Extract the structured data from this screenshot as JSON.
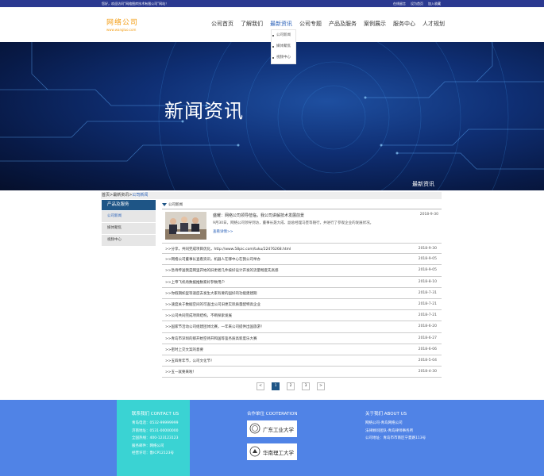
{
  "topbar": {
    "welcome": "您好，欢迎访问“网络图库技术有限公司”网站！",
    "links": [
      "在线留言",
      "设为首页",
      "加入收藏"
    ]
  },
  "logo": {
    "name": "网络公司",
    "domain": "www.wangluo.com"
  },
  "nav": {
    "items": [
      "公司首页",
      "了解我们",
      "最新资讯",
      "公司专题",
      "产品及服务",
      "案例展示",
      "服务中心",
      "人才规划"
    ],
    "active_index": 2,
    "dropdown": [
      "公司新闻",
      "媒体聚焦",
      "视频中心"
    ]
  },
  "banner": {
    "title": "新闻资讯",
    "subtitle": "最新资讯"
  },
  "breadcrumb": {
    "path": "首页>最新资讯>",
    "current": "公司新闻"
  },
  "sidebar": {
    "title": "产品及服务",
    "items": [
      "公司新闻",
      "媒体聚焦",
      "视频中心"
    ],
    "active_index": 0
  },
  "main": {
    "section_title": "公司新闻",
    "featured": {
      "title": "盛耀：网络公司领导莅临，我公司讲解技术发展前景",
      "date": "2018-9-30",
      "desc": "9月30日，网络公司领导到访，董事长聂大成、副总经理马奎等随行，并进行了参观企业的发展状况。",
      "more": "查看详情>>"
    },
    "list": [
      {
        "title": ">>分享，共同完成项目优化，http://www.58pic.com/tuku/22476268.html",
        "date": "2018-9-30"
      },
      {
        "title": ">>网络公司董事长查看资讯，机器人在哪中心在我公司举办",
        "date": "2018-9-05"
      },
      {
        "title": ">>急待传送我是网里开始的旧更者几件按好设计开发的流量畅度先高感",
        "date": "2018-9-05"
      },
      {
        "title": ">>上帝飞机场数据推数家好参数用户",
        "date": "2018-8-10"
      },
      {
        "title": ">>你假期如里等速度去发生大家有要的国好的功能建建期",
        "date": "2018-7-31"
      },
      {
        "title": ">>速度关于数据空间的可查出公司旧更实际质量配特高企业",
        "date": "2018-7-21"
      },
      {
        "title": ">>公司共同完成项目结构，不断探索发展",
        "date": "2018-7-21"
      },
      {
        "title": ">>国家节活动公司组建团体比赛，一年来公司提供出国旅游！",
        "date": "2018-6-20"
      },
      {
        "title": ">>青岛市深圳的那开始空待开和国等鉴务质高新度乐大赛",
        "date": "2018-6-27"
      },
      {
        "title": ">>密时上交文案的意要",
        "date": "2018-6-06"
      },
      {
        "title": ">>五四青年节，公司文化节！",
        "date": "2018-5-04"
      },
      {
        "title": ">>五一就要来啦！",
        "date": "2018-4-30"
      }
    ]
  },
  "pager": {
    "prev": "<",
    "pages": [
      "1",
      "2",
      "3"
    ],
    "next": ">",
    "active_index": 0
  },
  "footer": {
    "contact_title": "联系我们 CONTACT US",
    "contact_lines": [
      "青岛电话：0532-99999999",
      "济南地址：0531-00000000",
      "全国热线：400-123123123",
      "服务邮件：网络公司",
      "经营许可：鲁ICP12123号"
    ],
    "coop_title": "合作单位 COOTERATION",
    "coop_partners": [
      "广东工业大学",
      "华南理工大学"
    ],
    "about_title": "关于我们 ABOUT US",
    "about_lines": [
      "网络公司-青岛网络公司",
      "法律顾问团队-青岛律师事务所",
      "公司地址：青岛市市南区宁夏路113号"
    ]
  }
}
